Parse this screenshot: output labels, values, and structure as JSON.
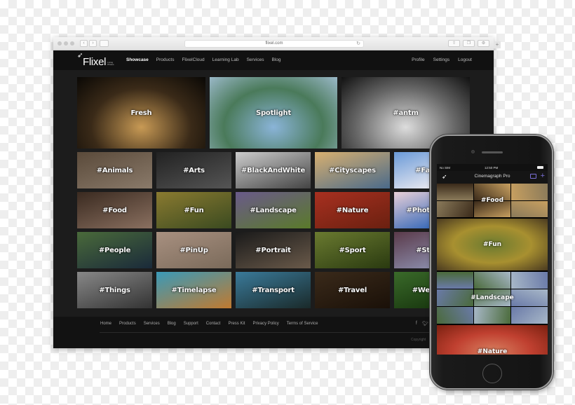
{
  "browser": {
    "url": "flixel.com"
  },
  "header": {
    "logo_text": "Flixel",
    "logo_sub": "Living Photos",
    "nav_left": [
      {
        "label": "Showcase",
        "active": true
      },
      {
        "label": "Products",
        "active": false
      },
      {
        "label": "FlixelCloud",
        "active": false
      },
      {
        "label": "Learning Lab",
        "active": false
      },
      {
        "label": "Services",
        "active": false
      },
      {
        "label": "Blog",
        "active": false
      }
    ],
    "nav_right": [
      {
        "label": "Profile"
      },
      {
        "label": "Settings"
      },
      {
        "label": "Logout"
      }
    ]
  },
  "featured": [
    {
      "label": "Fresh",
      "colors": [
        "#c89a55",
        "#3a2a18",
        "#0a0805"
      ]
    },
    {
      "label": "Spotlight",
      "colors": [
        "#8ab4d8",
        "#4a7a5a",
        "#9ab8c8"
      ]
    },
    {
      "label": "#antm",
      "colors": [
        "#ddd",
        "#666",
        "#111"
      ]
    }
  ],
  "categories": [
    [
      {
        "label": "#Animals",
        "colors": [
          "#5a4a3a",
          "#8a7a6a"
        ]
      },
      {
        "label": "#Arts",
        "colors": [
          "#222",
          "#555"
        ]
      },
      {
        "label": "#BlackAndWhite",
        "colors": [
          "#ccc",
          "#444"
        ]
      },
      {
        "label": "#Cityscapes",
        "colors": [
          "#d8b070",
          "#4a6a8a"
        ]
      },
      {
        "label": "#Fa",
        "colors": [
          "#6a9ad8",
          "#e8e8f0"
        ]
      }
    ],
    [
      {
        "label": "#Food",
        "colors": [
          "#3a2a20",
          "#8a7060"
        ]
      },
      {
        "label": "#Fun",
        "colors": [
          "#8a7a30",
          "#3a4a20"
        ]
      },
      {
        "label": "#Landscape",
        "colors": [
          "#6a5a8a",
          "#5a7a2a"
        ]
      },
      {
        "label": "#Nature",
        "colors": [
          "#a83020",
          "#6a2010"
        ]
      },
      {
        "label": "#Phot",
        "colors": [
          "#e8d0d8",
          "#3a6ab8"
        ]
      }
    ],
    [
      {
        "label": "#People",
        "colors": [
          "#4a6a3a",
          "#1a2a3a"
        ]
      },
      {
        "label": "#PinUp",
        "colors": [
          "#a89080",
          "#7a6a5a"
        ]
      },
      {
        "label": "#Portrait",
        "colors": [
          "#1a1a1a",
          "#6a5a4a"
        ]
      },
      {
        "label": "#Sport",
        "colors": [
          "#6a7a30",
          "#2a3a10"
        ]
      },
      {
        "label": "#St",
        "colors": [
          "#5a3a4a",
          "#8a8aa8"
        ]
      }
    ],
    [
      {
        "label": "#Things",
        "colors": [
          "#888",
          "#333"
        ]
      },
      {
        "label": "#Timelapse",
        "colors": [
          "#3a9ab8",
          "#c07a30"
        ]
      },
      {
        "label": "#Transport",
        "colors": [
          "#3a7a9a",
          "#1a2a2a"
        ]
      },
      {
        "label": "#Travel",
        "colors": [
          "#3a2a1a",
          "#1a1008"
        ]
      },
      {
        "label": "#We",
        "colors": [
          "#3a6a2a",
          "#1a3a10"
        ]
      }
    ]
  ],
  "footer": {
    "links": [
      "Home",
      "Products",
      "Services",
      "Blog",
      "Support",
      "Contact",
      "Press Kit",
      "Privacy Policy",
      "Terms of Service"
    ],
    "social": [
      "f",
      "t",
      "i"
    ],
    "copyright": "Copyright"
  },
  "phone": {
    "carrier": "No SIM",
    "time": "12:50 PM",
    "app_title": "Cinemagraph Pro",
    "feed": [
      {
        "label": "#Food",
        "colors": [
          "#8a7a5a",
          "#3a2a1a",
          "#c8a060"
        ]
      },
      {
        "label": "#Fun",
        "colors": [
          "#a89030",
          "#4a3a20",
          "#6a7a30"
        ]
      },
      {
        "label": "#Landscape",
        "colors": [
          "#6a7aa8",
          "#4a6a3a",
          "#a8b8c8"
        ]
      },
      {
        "label": "#Nature",
        "colors": [
          "#c04030",
          "#7a2010",
          "#d88060"
        ]
      }
    ]
  }
}
